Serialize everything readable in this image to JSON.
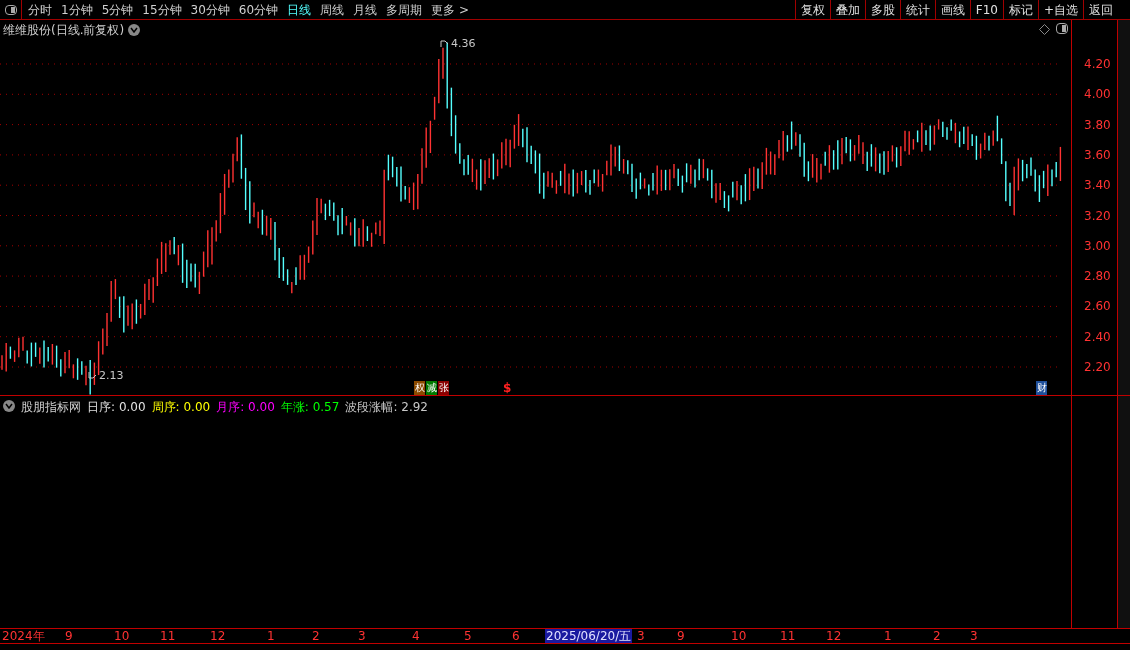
{
  "toolbar": {
    "periods": [
      {
        "label": "分时",
        "selected": false
      },
      {
        "label": "1分钟",
        "selected": false
      },
      {
        "label": "5分钟",
        "selected": false
      },
      {
        "label": "15分钟",
        "selected": false
      },
      {
        "label": "30分钟",
        "selected": false
      },
      {
        "label": "60分钟",
        "selected": false
      },
      {
        "label": "日线",
        "selected": true
      },
      {
        "label": "周线",
        "selected": false
      },
      {
        "label": "月线",
        "selected": false
      },
      {
        "label": "多周期",
        "selected": false
      },
      {
        "label": "更多 >",
        "selected": false
      }
    ],
    "buttons": [
      "复权",
      "叠加",
      "多股",
      "统计",
      "画线",
      "F10",
      "标记",
      "+自选",
      "返回"
    ]
  },
  "chart": {
    "title": "维维股份(日线.前复权)",
    "y_axis": [
      "4.20",
      "4.00",
      "3.80",
      "3.60",
      "3.40",
      "3.20",
      "3.00",
      "2.80",
      "2.60",
      "2.40",
      "2.20"
    ],
    "markers": [
      {
        "kind": "high",
        "text": "4.36"
      },
      {
        "kind": "low",
        "text": "2.13"
      },
      {
        "kind": "tag",
        "text": "权",
        "color": "#8b4a00"
      },
      {
        "kind": "tag",
        "text": "减",
        "color": "#007a00"
      },
      {
        "kind": "tag",
        "text": "张",
        "color": "#8b0000"
      },
      {
        "kind": "signal",
        "text": "$"
      },
      {
        "kind": "tag",
        "text": "财",
        "color": "#1e4f9a"
      }
    ]
  },
  "indicator": {
    "name": "股朋指标网",
    "values": [
      {
        "label": "日序:",
        "value": "0.00",
        "color": "#e0e0e0"
      },
      {
        "label": "周序:",
        "value": "0.00",
        "color": "#ffff00"
      },
      {
        "label": "月序:",
        "value": "0.00",
        "color": "#ff00ff"
      },
      {
        "label": "年涨:",
        "value": "0.57",
        "color": "#00ff00"
      },
      {
        "label": "波段涨幅:",
        "value": "2.92",
        "color": "#c8c8c8"
      }
    ]
  },
  "time_axis": [
    {
      "label": "2024年",
      "selected": false
    },
    {
      "label": "9",
      "selected": false
    },
    {
      "label": "10",
      "selected": false
    },
    {
      "label": "11",
      "selected": false
    },
    {
      "label": "12",
      "selected": false
    },
    {
      "label": "1",
      "selected": false
    },
    {
      "label": "2",
      "selected": false
    },
    {
      "label": "3",
      "selected": false
    },
    {
      "label": "4",
      "selected": false
    },
    {
      "label": "5",
      "selected": false
    },
    {
      "label": "6",
      "selected": false
    },
    {
      "label": "2025/06/20/五",
      "selected": true
    },
    {
      "label": "3",
      "selected": false
    },
    {
      "label": "9",
      "selected": false
    },
    {
      "label": "10",
      "selected": false
    },
    {
      "label": "11",
      "selected": false
    },
    {
      "label": "12",
      "selected": false
    },
    {
      "label": "1",
      "selected": false
    },
    {
      "label": "2",
      "selected": false
    },
    {
      "label": "3",
      "selected": false
    }
  ]
}
